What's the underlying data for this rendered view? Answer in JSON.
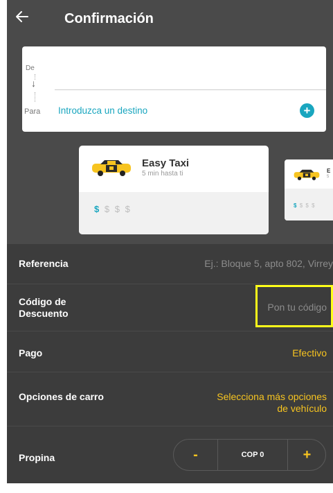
{
  "header": {
    "title": "Confirmación"
  },
  "route": {
    "from_label": "De",
    "to_label": "Para",
    "destination_placeholder": "Introduzca un destino"
  },
  "taxi_options": [
    {
      "name": "Easy Taxi",
      "eta": "5 min hasta ti",
      "price_symbols": [
        "$",
        "$",
        "$",
        "$"
      ],
      "price_level": 1
    },
    {
      "name": "E",
      "eta": "5",
      "price_symbols": [
        "$",
        "$",
        "$",
        "$"
      ],
      "price_level": 1
    }
  ],
  "settings": {
    "reference": {
      "label": "Referencia",
      "placeholder": "Ej.: Bloque 5, apto 802, Virrey"
    },
    "discount": {
      "label_line1": "Código de",
      "label_line2": "Descuento",
      "placeholder": "Pon tu código"
    },
    "payment": {
      "label": "Pago",
      "value": "Efectivo"
    },
    "car_options": {
      "label": "Opciones de carro",
      "value_line1": "Selecciona más opciones",
      "value_line2": "de vehículo"
    },
    "tip": {
      "label": "Propina",
      "minus": "-",
      "value": "COP 0",
      "plus": "+"
    }
  },
  "colors": {
    "accent_yellow": "#f7c420",
    "accent_teal": "#19a6bf",
    "highlight": "#ffff1a",
    "header_bg": "#4a4a4a",
    "list_bg": "#3c3c3c"
  },
  "icons": {
    "back": "arrow-left-icon",
    "add_destination": "plus-circle-icon",
    "taxi": "taxi-car-icon"
  }
}
